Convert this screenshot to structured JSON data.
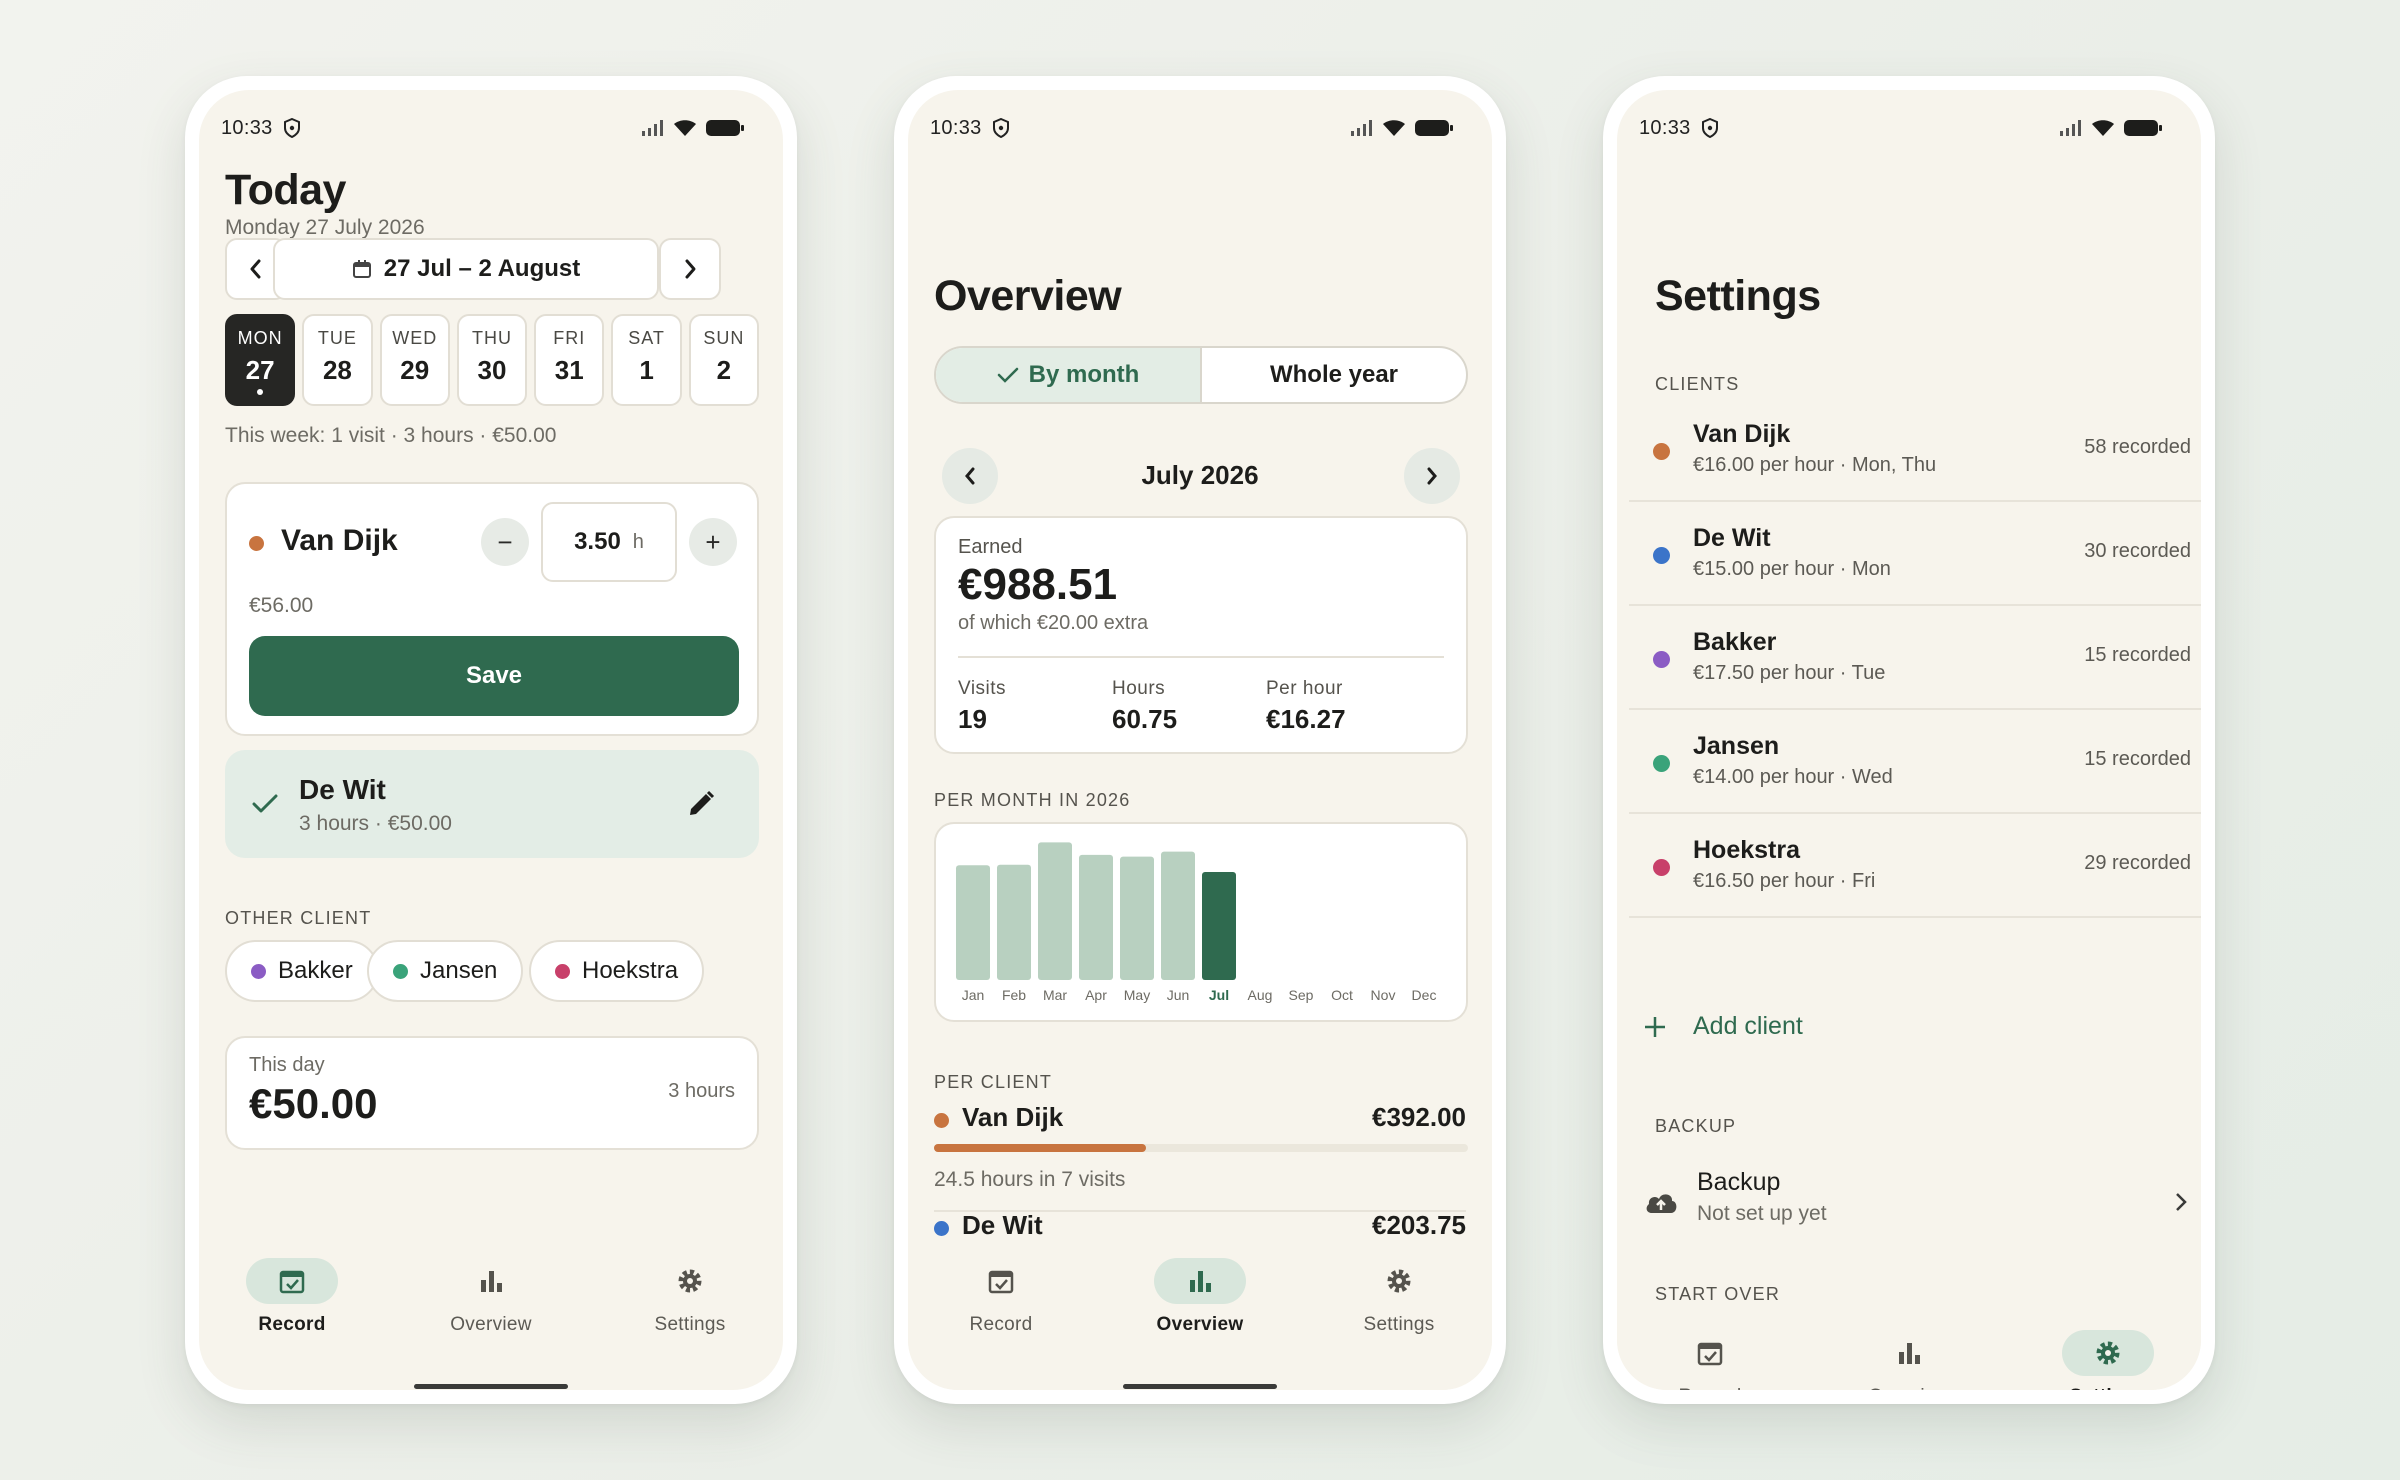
{
  "status": {
    "time": "10:33"
  },
  "record": {
    "title": "Today",
    "date": "Monday 27 July 2026",
    "range": "27 Jul – 2 August",
    "days": [
      {
        "name": "MON",
        "num": "27"
      },
      {
        "name": "TUE",
        "num": "28"
      },
      {
        "name": "WED",
        "num": "29"
      },
      {
        "name": "THU",
        "num": "30"
      },
      {
        "name": "FRI",
        "num": "31"
      },
      {
        "name": "SAT",
        "num": "1"
      },
      {
        "name": "SUN",
        "num": "2"
      }
    ],
    "week_summary": "This week: 1 visit · 3 hours · €50.00",
    "entry": {
      "client": "Van Dijk",
      "hours": "3.50",
      "unit": "h",
      "amount": "€56.00",
      "save": "Save",
      "minus": "−",
      "plus": "+",
      "color": "#c8743f"
    },
    "done": {
      "client": "De Wit",
      "detail": "3 hours · €50.00"
    },
    "other_label": "OTHER CLIENT",
    "others": [
      {
        "name": "Bakker",
        "color": "#8b5cc4"
      },
      {
        "name": "Jansen",
        "color": "#3aa37a"
      },
      {
        "name": "Hoekstra",
        "color": "#c8406a"
      }
    ],
    "this_day": {
      "label": "This day",
      "amount": "€50.00",
      "hours": "3 hours"
    }
  },
  "overview": {
    "title": "Overview",
    "seg_month": "By month",
    "seg_year": "Whole year",
    "month": "July 2026",
    "earned_label": "Earned",
    "earned": "€988.51",
    "extra": "of which €20.00 extra",
    "stats": [
      {
        "label": "Visits",
        "value": "19"
      },
      {
        "label": "Hours",
        "value": "60.75"
      },
      {
        "label": "Per hour",
        "value": "€16.27"
      }
    ],
    "chart_label": "PER MONTH IN 2026",
    "per_client_label": "PER CLIENT",
    "clients": [
      {
        "name": "Van Dijk",
        "amount": "€392.00",
        "sub": "24.5 hours in 7 visits",
        "color": "#c8743f",
        "share": 0.397
      },
      {
        "name": "De Wit",
        "amount": "€203.75",
        "color": "#3b74c9"
      }
    ]
  },
  "chart_data": {
    "type": "bar",
    "title": "PER MONTH IN 2026",
    "categories": [
      "Jan",
      "Feb",
      "Mar",
      "Apr",
      "May",
      "Jun",
      "Jul",
      "Aug",
      "Sep",
      "Oct",
      "Nov",
      "Dec"
    ],
    "values": [
      1050,
      1055,
      1260,
      1145,
      1130,
      1175,
      988.51,
      0,
      0,
      0,
      0,
      0
    ],
    "highlight": "Jul",
    "ylim": [
      0,
      1300
    ],
    "grid": false,
    "colors": {
      "bar": "#b8d0c0",
      "highlight": "#2f6a4f"
    }
  },
  "settings": {
    "title": "Settings",
    "clients_label": "CLIENTS",
    "clients": [
      {
        "name": "Van Dijk",
        "sub": "€16.00 per hour · Mon, Thu",
        "count": "58 recorded",
        "color": "#c8743f"
      },
      {
        "name": "De Wit",
        "sub": "€15.00 per hour · Mon",
        "count": "30 recorded",
        "color": "#3b74c9"
      },
      {
        "name": "Bakker",
        "sub": "€17.50 per hour · Tue",
        "count": "15 recorded",
        "color": "#8b5cc4"
      },
      {
        "name": "Jansen",
        "sub": "€14.00 per hour · Wed",
        "count": "15 recorded",
        "color": "#3aa37a"
      },
      {
        "name": "Hoekstra",
        "sub": "€16.50 per hour · Fri",
        "count": "29 recorded",
        "color": "#c8406a"
      }
    ],
    "add_client": "Add client",
    "backup_label": "BACKUP",
    "backup_title": "Backup",
    "backup_sub": "Not set up yet",
    "start_over_label": "START OVER"
  },
  "nav": {
    "record": "Record",
    "overview": "Overview",
    "settings": "Settings"
  },
  "colors": {
    "accent": "#2f6a4f",
    "background": "#f7f4ec"
  },
  "icons": [
    "shield-icon",
    "signal-icon",
    "wifi-icon",
    "battery-icon",
    "chevron-left-icon",
    "chevron-right-icon",
    "calendar-icon",
    "check-icon",
    "pencil-icon",
    "calendar-check-icon",
    "bar-chart-icon",
    "gear-icon",
    "plus-icon",
    "cloud-upload-icon"
  ]
}
